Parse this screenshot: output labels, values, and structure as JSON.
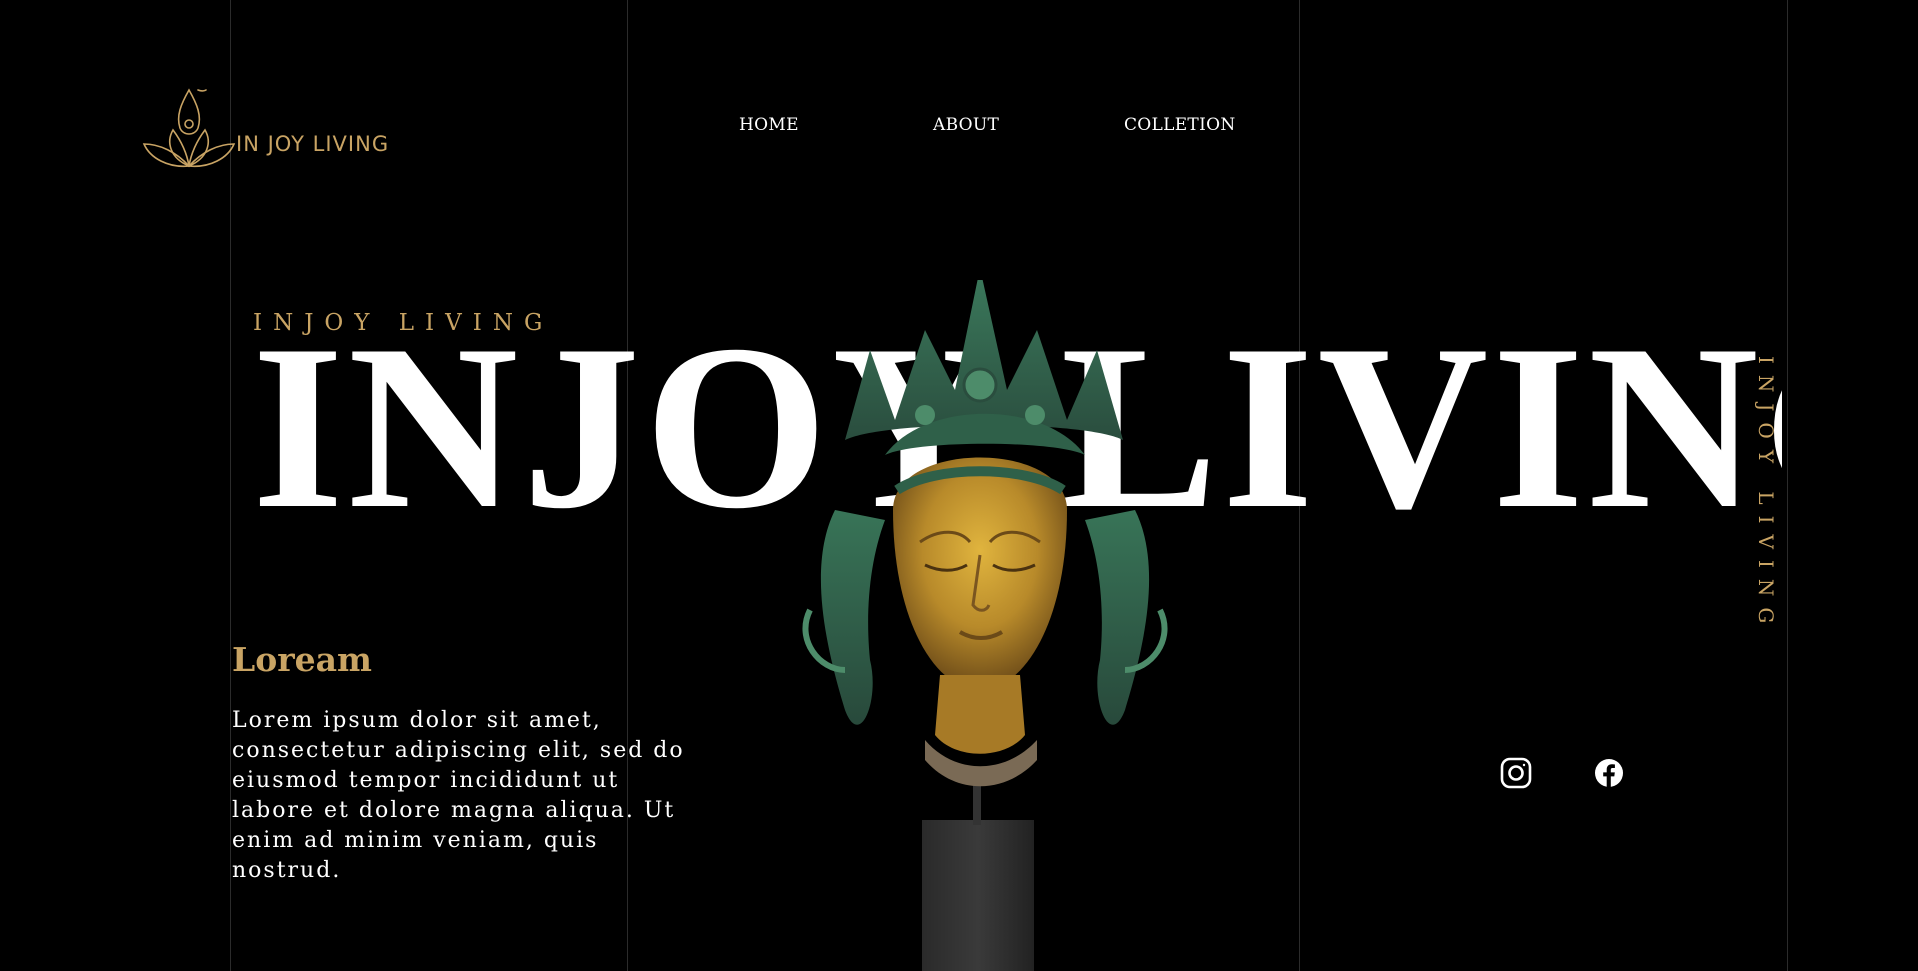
{
  "brand": {
    "logo_text": "IN JOY LIVING",
    "accent_color": "#c9a464"
  },
  "nav": {
    "items": [
      {
        "label": "HOME"
      },
      {
        "label": "ABOUT"
      },
      {
        "label": "COLLETION"
      }
    ]
  },
  "hero": {
    "tagline": "INJOY LIVING",
    "title": "INJOY LIVING",
    "vertical_text": "INJOY LIVING",
    "image": {
      "icon": "buddha-head-statue"
    }
  },
  "copy": {
    "heading": "Loream",
    "body": "Lorem ipsum dolor sit amet, consectetur adipiscing elit, sed do eiusmod tempor incididunt ut labore et dolore magna aliqua. Ut enim ad minim veniam, quis nostrud."
  },
  "socials": [
    {
      "icon": "instagram-icon"
    },
    {
      "icon": "facebook-icon"
    }
  ],
  "colors": {
    "background": "#000000",
    "text": "#ffffff",
    "accent": "#c9a464"
  }
}
